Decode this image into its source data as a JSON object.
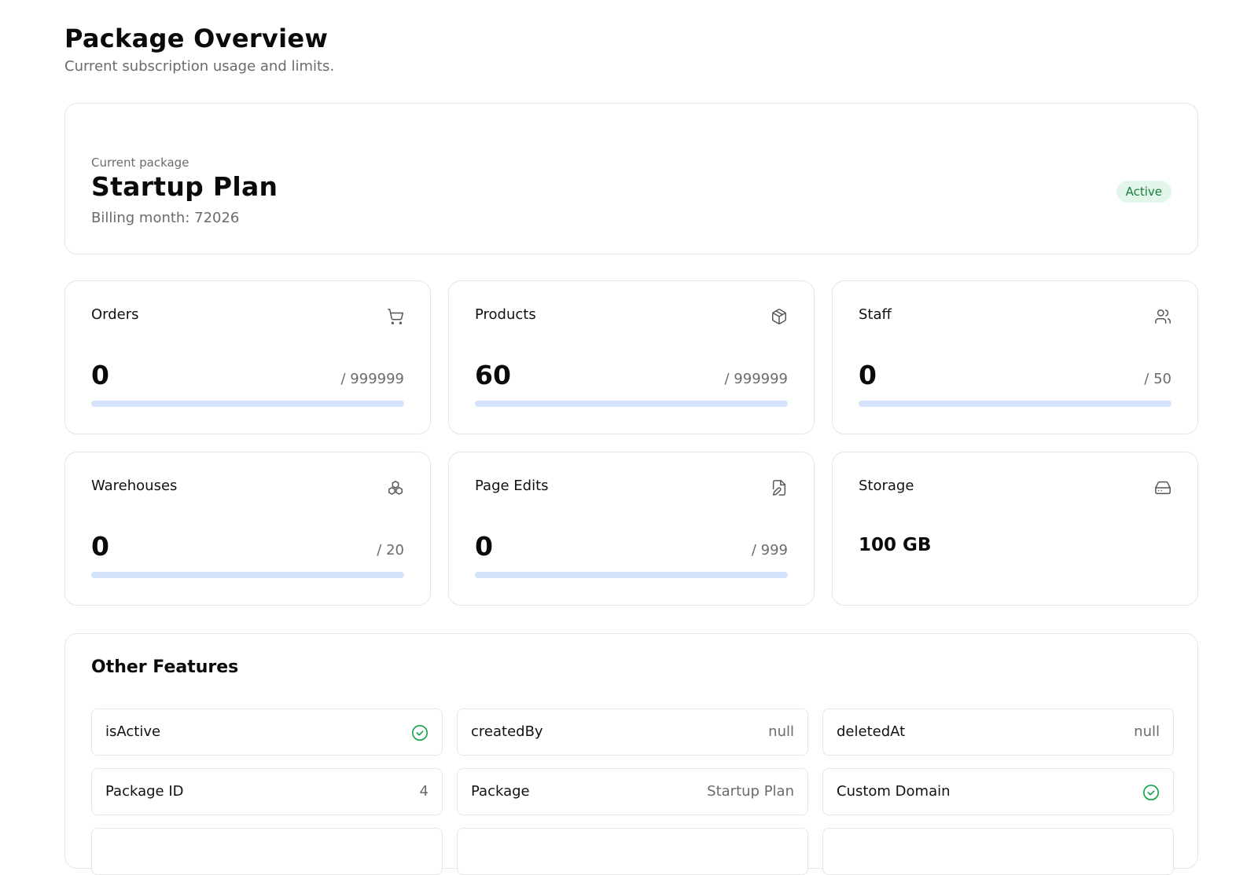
{
  "header": {
    "title": "Package Overview",
    "subtitle": "Current subscription usage and limits."
  },
  "package": {
    "eyebrow": "Current package",
    "name": "Startup Plan",
    "billing": "Billing month: 72026",
    "status": "Active"
  },
  "colors": {
    "active_badge_bg": "#e3f6ea",
    "active_badge_text": "#15803d",
    "progress_track": "#d3e3fb",
    "progress_fill": "#3b82f6",
    "check_icon": "#16a34a"
  },
  "stats": [
    {
      "label": "Orders",
      "value": "0",
      "limit": "/ 999999",
      "icon": "cart-icon",
      "progress": 0
    },
    {
      "label": "Products",
      "value": "60",
      "limit": "/ 999999",
      "icon": "package-icon",
      "progress": 6e-05
    },
    {
      "label": "Staff",
      "value": "0",
      "limit": "/ 50",
      "icon": "users-icon",
      "progress": 0
    },
    {
      "label": "Warehouses",
      "value": "0",
      "limit": "/ 20",
      "icon": "boxes-icon",
      "progress": 0
    },
    {
      "label": "Page Edits",
      "value": "0",
      "limit": "/ 999",
      "icon": "file-edit-icon",
      "progress": 0
    },
    {
      "label": "Storage",
      "value": "100 GB",
      "icon": "hard-drive-icon"
    }
  ],
  "features": {
    "title": "Other Features",
    "items": [
      {
        "label": "isActive",
        "check": true
      },
      {
        "label": "createdBy",
        "value": "null"
      },
      {
        "label": "deletedAt",
        "value": "null"
      },
      {
        "label": "Package ID",
        "value": "4"
      },
      {
        "label": "Package",
        "value": "Startup Plan"
      },
      {
        "label": "Custom Domain",
        "check": true
      },
      {
        "label": "",
        "value": ""
      },
      {
        "label": "",
        "value": ""
      },
      {
        "label": "",
        "value": ""
      }
    ]
  }
}
